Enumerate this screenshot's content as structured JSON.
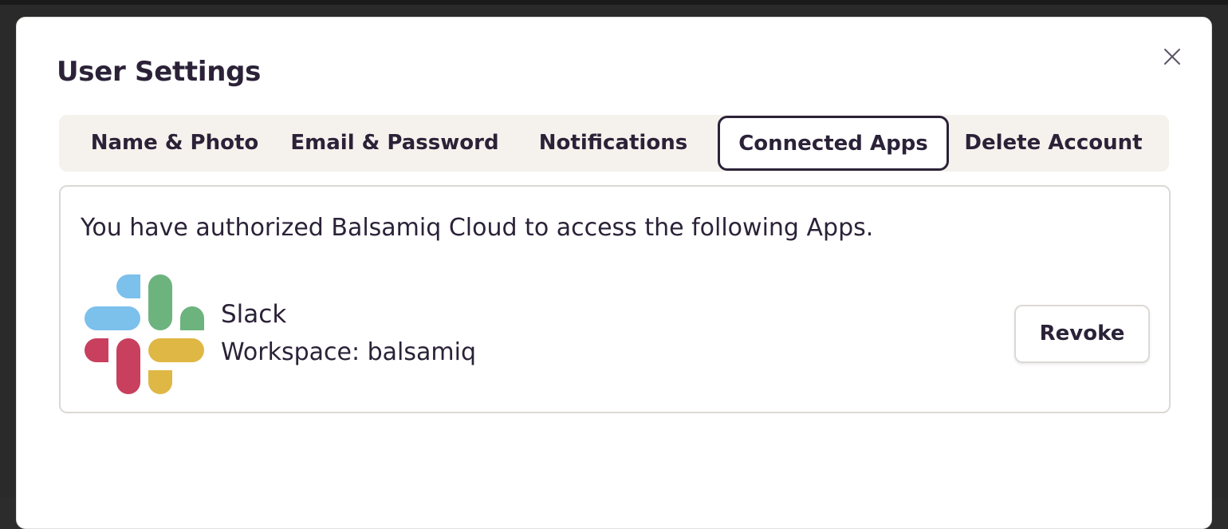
{
  "dialog": {
    "title": "User Settings"
  },
  "tabs": [
    {
      "label": "Name & Photo",
      "active": false
    },
    {
      "label": "Email & Password",
      "active": false
    },
    {
      "label": "Notifications",
      "active": false
    },
    {
      "label": "Connected Apps",
      "active": true
    },
    {
      "label": "Delete Account",
      "active": false
    }
  ],
  "connected_apps": {
    "intro": "You have authorized Balsamiq Cloud to access the following Apps.",
    "apps": [
      {
        "name": "Slack",
        "workspace": "Workspace: balsamiq",
        "icon": "slack-logo",
        "action_label": "Revoke"
      }
    ]
  },
  "colors": {
    "text": "#2b2238",
    "tab_bar_bg": "#f5f1ec",
    "panel_border": "#dcd9d5",
    "slack_blue": "#7cc0ec",
    "slack_green": "#6db37e",
    "slack_red": "#c8405e",
    "slack_yellow": "#dfb745"
  }
}
